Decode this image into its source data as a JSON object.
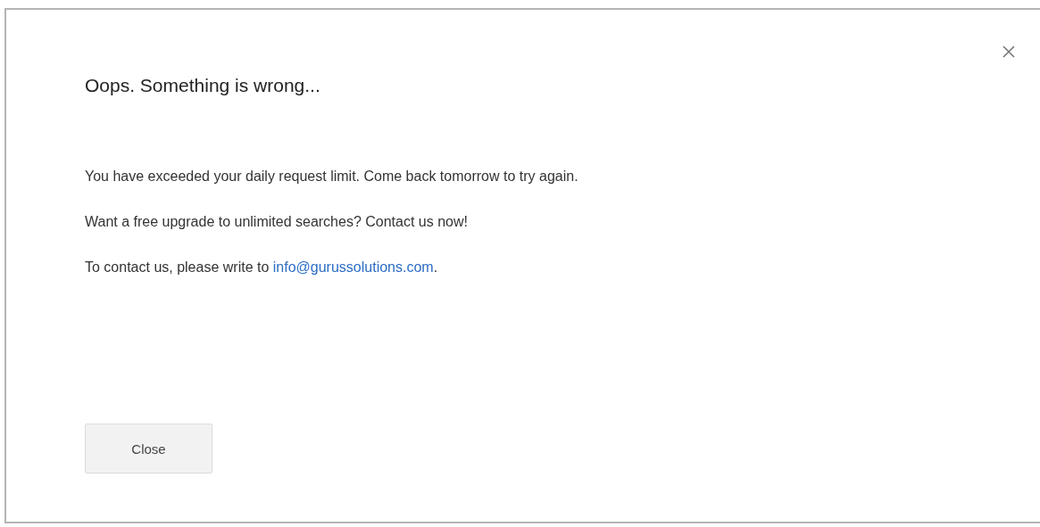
{
  "dialog": {
    "title": "Oops. Something is wrong...",
    "paragraphs": [
      {
        "text": "You have exceeded your daily request limit. Come back tomorrow to try again."
      },
      {
        "text": "Want a free upgrade to unlimited searches? Contact us now!"
      },
      {
        "text": "To contact us, please write to ",
        "link": "info@gurussolutions.com",
        "after": "."
      }
    ],
    "buttons": [
      {
        "label": "Close"
      }
    ]
  }
}
